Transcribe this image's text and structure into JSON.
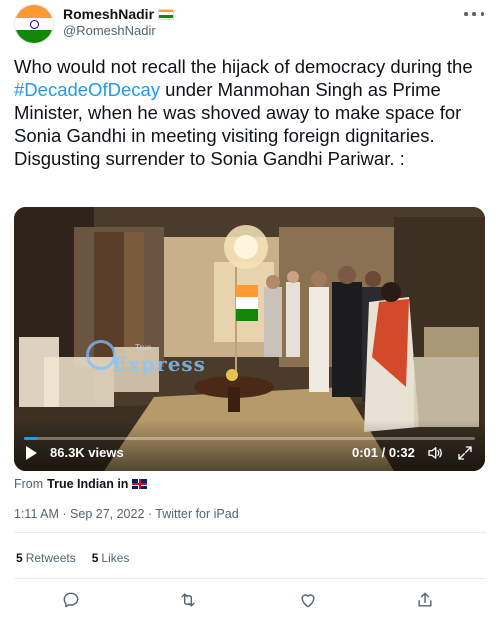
{
  "author": {
    "display_name": "RomeshNadir",
    "handle": "@RomeshNadir",
    "avatar_icon": "india-flag-avatar",
    "name_flag_icon": "india-flag-icon"
  },
  "tweet": {
    "text_before": "Who would not recall the hijack of democracy during the ",
    "hashtag": "#DecadeOfDecay",
    "text_after": " under Manmohan Singh as Prime Minister, when he was shoved away to make space for Sonia Gandhi in meeting visiting foreign dignitaries. Disgusting surrender to Sonia Gandhi Pariwar. :"
  },
  "video": {
    "views": "86.3K views",
    "time": "0:01 / 0:32",
    "watermark": "Express",
    "watermark_small": "True",
    "progress": 0.03,
    "accent": "#1d9bf0"
  },
  "source": {
    "prefix": "From",
    "name": "True Indian in",
    "flag_icon": "uk-flag-icon"
  },
  "meta": {
    "timestamp": "1:11 AM · Sep 27, 2022 · Twitter for iPad"
  },
  "stats": {
    "retweets_count": "5",
    "retweets_label": "Retweets",
    "likes_count": "5",
    "likes_label": "Likes"
  },
  "actions": [
    "reply-icon",
    "retweet-icon",
    "like-icon",
    "share-icon"
  ]
}
